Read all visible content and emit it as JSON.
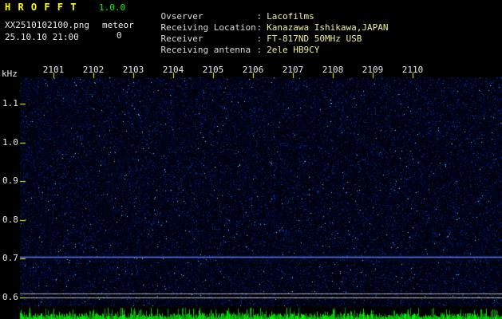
{
  "app": {
    "title": "H R O F F T",
    "version": "1.0.0",
    "filename": "XX2510102100.png",
    "mode": "meteor",
    "count": "0",
    "datetime": "25.10.10 21:00"
  },
  "info": {
    "colon": ":",
    "rows": [
      {
        "label": "Ovserver",
        "value": "Lacofilms"
      },
      {
        "label": "Receiving Location",
        "value": "Kanazawa Ishikawa,JAPAN"
      },
      {
        "label": "Receiver",
        "value": "FT-817ND 50MHz USB"
      },
      {
        "label": "Receiving antenna",
        "value": "2ele HB9CY"
      }
    ]
  },
  "chart_data": {
    "type": "heatmap",
    "subtype": "radio-meteor-spectrogram",
    "title": "",
    "x_axis": "time (HHMM)",
    "x_ticks": [
      "2101",
      "2102",
      "2103",
      "2104",
      "2105",
      "2106",
      "2107",
      "2108",
      "2109",
      "2110"
    ],
    "y_label": "kHz",
    "y_ticks": [
      1.1,
      1.0,
      0.9,
      0.8,
      0.7,
      0.6
    ],
    "y_range_khz": [
      0.575,
      1.17
    ],
    "grid": "off",
    "legend": "none",
    "noise_floor": "dense dark-blue speckle over black",
    "carrier_lines": [
      {
        "khz": 0.705,
        "color": "#5c8cff",
        "intensity": "bright"
      },
      {
        "khz": 0.61,
        "color": "#c8c8c8",
        "intensity": "dim"
      },
      {
        "khz": 0.598,
        "color": "#e0e0c0",
        "intensity": "dim"
      }
    ],
    "meteor_echo_count": 0,
    "signal_level_strip": "green vertical bars along full width of bottom edge"
  },
  "colors": {
    "background": "#000000",
    "title": "#ffff00",
    "version": "#00ff00",
    "white_text": "#e8e8e8",
    "info_label": "#d9d9d9",
    "info_value": "#efef9c",
    "tick": "#ffff00",
    "noise_blue": "#0a1e78",
    "bright_speck": "#6ec8ff",
    "strip_green": "#00d200"
  }
}
